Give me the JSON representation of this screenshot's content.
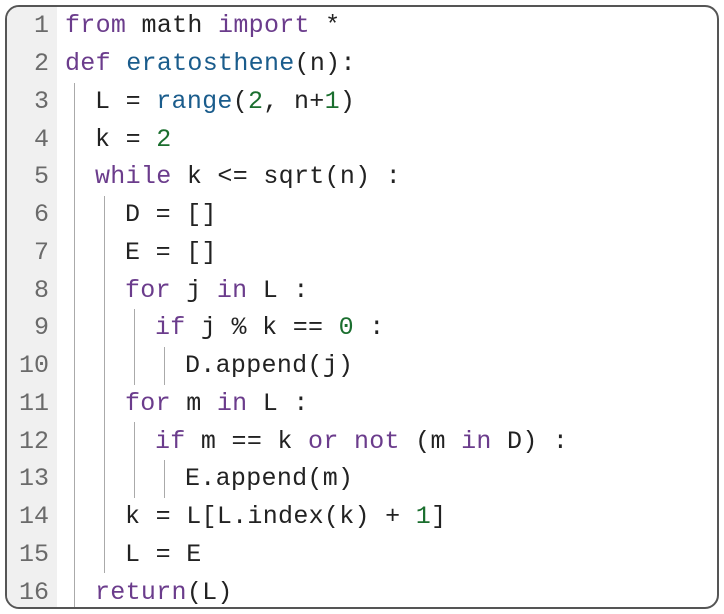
{
  "code": {
    "lines": [
      {
        "num": "1",
        "indent": 0,
        "tokens": [
          {
            "t": "from ",
            "c": "kw"
          },
          {
            "t": "math ",
            "c": "txt"
          },
          {
            "t": "import ",
            "c": "kw"
          },
          {
            "t": "*",
            "c": "txt"
          }
        ]
      },
      {
        "num": "2",
        "indent": 0,
        "tokens": [
          {
            "t": "def ",
            "c": "kw"
          },
          {
            "t": "eratosthene",
            "c": "fn"
          },
          {
            "t": "(n):",
            "c": "txt"
          }
        ]
      },
      {
        "num": "3",
        "indent": 1,
        "tokens": [
          {
            "t": "L = ",
            "c": "txt"
          },
          {
            "t": "range",
            "c": "fn"
          },
          {
            "t": "(",
            "c": "txt"
          },
          {
            "t": "2",
            "c": "num"
          },
          {
            "t": ", n+",
            "c": "txt"
          },
          {
            "t": "1",
            "c": "num"
          },
          {
            "t": ")",
            "c": "txt"
          }
        ]
      },
      {
        "num": "4",
        "indent": 1,
        "tokens": [
          {
            "t": "k = ",
            "c": "txt"
          },
          {
            "t": "2",
            "c": "num"
          }
        ]
      },
      {
        "num": "5",
        "indent": 1,
        "tokens": [
          {
            "t": "while ",
            "c": "kw"
          },
          {
            "t": "k <= sqrt(n) :",
            "c": "txt"
          }
        ]
      },
      {
        "num": "6",
        "indent": 2,
        "tokens": [
          {
            "t": "D = []",
            "c": "txt"
          }
        ]
      },
      {
        "num": "7",
        "indent": 2,
        "tokens": [
          {
            "t": "E = []",
            "c": "txt"
          }
        ]
      },
      {
        "num": "8",
        "indent": 2,
        "tokens": [
          {
            "t": "for ",
            "c": "kw"
          },
          {
            "t": "j ",
            "c": "txt"
          },
          {
            "t": "in ",
            "c": "kw"
          },
          {
            "t": "L :",
            "c": "txt"
          }
        ]
      },
      {
        "num": "9",
        "indent": 3,
        "tokens": [
          {
            "t": "if ",
            "c": "kw"
          },
          {
            "t": "j % k == ",
            "c": "txt"
          },
          {
            "t": "0",
            "c": "num"
          },
          {
            "t": " :",
            "c": "txt"
          }
        ]
      },
      {
        "num": "10",
        "indent": 4,
        "tokens": [
          {
            "t": "D.append(j)",
            "c": "txt"
          }
        ]
      },
      {
        "num": "11",
        "indent": 2,
        "tokens": [
          {
            "t": "for ",
            "c": "kw"
          },
          {
            "t": "m ",
            "c": "txt"
          },
          {
            "t": "in ",
            "c": "kw"
          },
          {
            "t": "L :",
            "c": "txt"
          }
        ]
      },
      {
        "num": "12",
        "indent": 3,
        "tokens": [
          {
            "t": "if ",
            "c": "kw"
          },
          {
            "t": "m == k ",
            "c": "txt"
          },
          {
            "t": "or not ",
            "c": "kw"
          },
          {
            "t": "(m ",
            "c": "txt"
          },
          {
            "t": "in ",
            "c": "kw"
          },
          {
            "t": "D) :",
            "c": "txt"
          }
        ]
      },
      {
        "num": "13",
        "indent": 4,
        "tokens": [
          {
            "t": "E.append(m)",
            "c": "txt"
          }
        ]
      },
      {
        "num": "14",
        "indent": 2,
        "tokens": [
          {
            "t": "k = L[L.index(k) + ",
            "c": "txt"
          },
          {
            "t": "1",
            "c": "num"
          },
          {
            "t": "]",
            "c": "txt"
          }
        ]
      },
      {
        "num": "15",
        "indent": 2,
        "tokens": [
          {
            "t": "L = E",
            "c": "txt"
          }
        ]
      },
      {
        "num": "16",
        "indent": 1,
        "tokens": [
          {
            "t": "return",
            "c": "kw"
          },
          {
            "t": "(L)",
            "c": "txt"
          }
        ]
      }
    ]
  }
}
